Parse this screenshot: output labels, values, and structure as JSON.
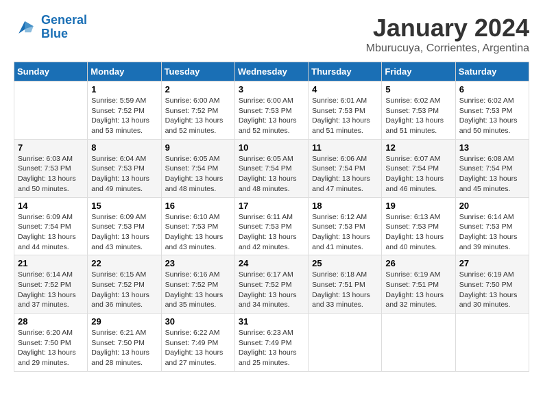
{
  "logo": {
    "line1": "General",
    "line2": "Blue"
  },
  "title": "January 2024",
  "subtitle": "Mburucuya, Corrientes, Argentina",
  "days_of_week": [
    "Sunday",
    "Monday",
    "Tuesday",
    "Wednesday",
    "Thursday",
    "Friday",
    "Saturday"
  ],
  "weeks": [
    [
      {
        "day": null,
        "info": null
      },
      {
        "day": "1",
        "info": "Sunrise: 5:59 AM\nSunset: 7:52 PM\nDaylight: 13 hours\nand 53 minutes."
      },
      {
        "day": "2",
        "info": "Sunrise: 6:00 AM\nSunset: 7:52 PM\nDaylight: 13 hours\nand 52 minutes."
      },
      {
        "day": "3",
        "info": "Sunrise: 6:00 AM\nSunset: 7:53 PM\nDaylight: 13 hours\nand 52 minutes."
      },
      {
        "day": "4",
        "info": "Sunrise: 6:01 AM\nSunset: 7:53 PM\nDaylight: 13 hours\nand 51 minutes."
      },
      {
        "day": "5",
        "info": "Sunrise: 6:02 AM\nSunset: 7:53 PM\nDaylight: 13 hours\nand 51 minutes."
      },
      {
        "day": "6",
        "info": "Sunrise: 6:02 AM\nSunset: 7:53 PM\nDaylight: 13 hours\nand 50 minutes."
      }
    ],
    [
      {
        "day": "7",
        "info": "Sunrise: 6:03 AM\nSunset: 7:53 PM\nDaylight: 13 hours\nand 50 minutes."
      },
      {
        "day": "8",
        "info": "Sunrise: 6:04 AM\nSunset: 7:53 PM\nDaylight: 13 hours\nand 49 minutes."
      },
      {
        "day": "9",
        "info": "Sunrise: 6:05 AM\nSunset: 7:54 PM\nDaylight: 13 hours\nand 48 minutes."
      },
      {
        "day": "10",
        "info": "Sunrise: 6:05 AM\nSunset: 7:54 PM\nDaylight: 13 hours\nand 48 minutes."
      },
      {
        "day": "11",
        "info": "Sunrise: 6:06 AM\nSunset: 7:54 PM\nDaylight: 13 hours\nand 47 minutes."
      },
      {
        "day": "12",
        "info": "Sunrise: 6:07 AM\nSunset: 7:54 PM\nDaylight: 13 hours\nand 46 minutes."
      },
      {
        "day": "13",
        "info": "Sunrise: 6:08 AM\nSunset: 7:54 PM\nDaylight: 13 hours\nand 45 minutes."
      }
    ],
    [
      {
        "day": "14",
        "info": "Sunrise: 6:09 AM\nSunset: 7:54 PM\nDaylight: 13 hours\nand 44 minutes."
      },
      {
        "day": "15",
        "info": "Sunrise: 6:09 AM\nSunset: 7:53 PM\nDaylight: 13 hours\nand 43 minutes."
      },
      {
        "day": "16",
        "info": "Sunrise: 6:10 AM\nSunset: 7:53 PM\nDaylight: 13 hours\nand 43 minutes."
      },
      {
        "day": "17",
        "info": "Sunrise: 6:11 AM\nSunset: 7:53 PM\nDaylight: 13 hours\nand 42 minutes."
      },
      {
        "day": "18",
        "info": "Sunrise: 6:12 AM\nSunset: 7:53 PM\nDaylight: 13 hours\nand 41 minutes."
      },
      {
        "day": "19",
        "info": "Sunrise: 6:13 AM\nSunset: 7:53 PM\nDaylight: 13 hours\nand 40 minutes."
      },
      {
        "day": "20",
        "info": "Sunrise: 6:14 AM\nSunset: 7:53 PM\nDaylight: 13 hours\nand 39 minutes."
      }
    ],
    [
      {
        "day": "21",
        "info": "Sunrise: 6:14 AM\nSunset: 7:52 PM\nDaylight: 13 hours\nand 37 minutes."
      },
      {
        "day": "22",
        "info": "Sunrise: 6:15 AM\nSunset: 7:52 PM\nDaylight: 13 hours\nand 36 minutes."
      },
      {
        "day": "23",
        "info": "Sunrise: 6:16 AM\nSunset: 7:52 PM\nDaylight: 13 hours\nand 35 minutes."
      },
      {
        "day": "24",
        "info": "Sunrise: 6:17 AM\nSunset: 7:52 PM\nDaylight: 13 hours\nand 34 minutes."
      },
      {
        "day": "25",
        "info": "Sunrise: 6:18 AM\nSunset: 7:51 PM\nDaylight: 13 hours\nand 33 minutes."
      },
      {
        "day": "26",
        "info": "Sunrise: 6:19 AM\nSunset: 7:51 PM\nDaylight: 13 hours\nand 32 minutes."
      },
      {
        "day": "27",
        "info": "Sunrise: 6:19 AM\nSunset: 7:50 PM\nDaylight: 13 hours\nand 30 minutes."
      }
    ],
    [
      {
        "day": "28",
        "info": "Sunrise: 6:20 AM\nSunset: 7:50 PM\nDaylight: 13 hours\nand 29 minutes."
      },
      {
        "day": "29",
        "info": "Sunrise: 6:21 AM\nSunset: 7:50 PM\nDaylight: 13 hours\nand 28 minutes."
      },
      {
        "day": "30",
        "info": "Sunrise: 6:22 AM\nSunset: 7:49 PM\nDaylight: 13 hours\nand 27 minutes."
      },
      {
        "day": "31",
        "info": "Sunrise: 6:23 AM\nSunset: 7:49 PM\nDaylight: 13 hours\nand 25 minutes."
      },
      {
        "day": null,
        "info": null
      },
      {
        "day": null,
        "info": null
      },
      {
        "day": null,
        "info": null
      }
    ]
  ]
}
